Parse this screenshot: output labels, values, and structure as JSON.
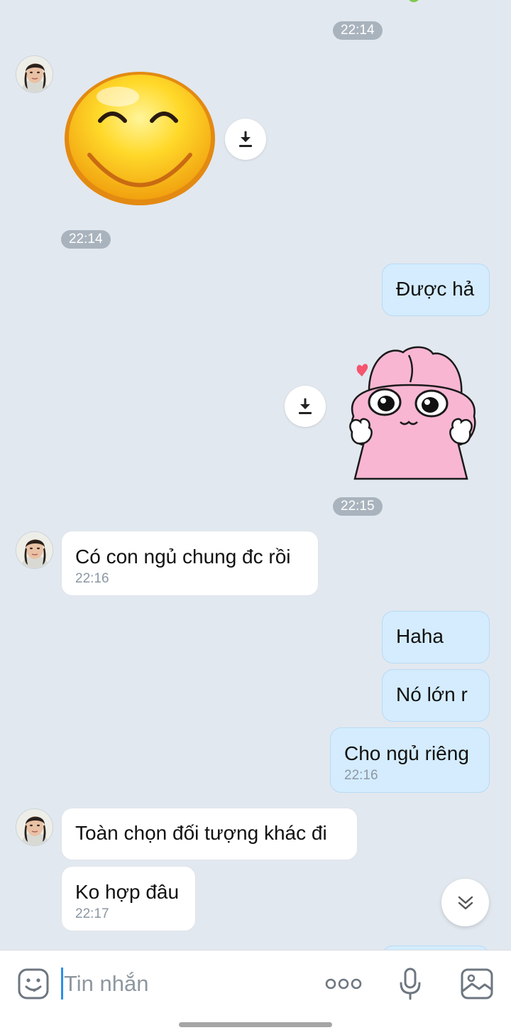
{
  "messages": {
    "t1": "22:14",
    "sticker1_time": "22:14",
    "out1": "Được hả",
    "sticker2_time": "22:15",
    "in1": {
      "text": "Có con ngủ chung đc rồi",
      "time": "22:16"
    },
    "out2": "Haha",
    "out3": "Nó lớn r",
    "out4": {
      "text": "Cho ngủ riêng",
      "time": "22:16"
    },
    "in2": "Toàn chọn đối tượng khác đi",
    "in3": {
      "text": "Ko hợp đâu",
      "time": "22:17"
    }
  },
  "composer": {
    "placeholder": "Tin nhắn"
  },
  "colors": {
    "background": "#e2e8ef",
    "incoming_bubble": "#ffffff",
    "outgoing_bubble": "#d4ecfd",
    "time_pill": "#a9b3bd",
    "cursor": "#2b8fe8"
  },
  "icons": [
    "download-icon",
    "scroll-down-icon",
    "emoji-icon",
    "more-options-icon",
    "microphone-icon",
    "image-icon"
  ]
}
